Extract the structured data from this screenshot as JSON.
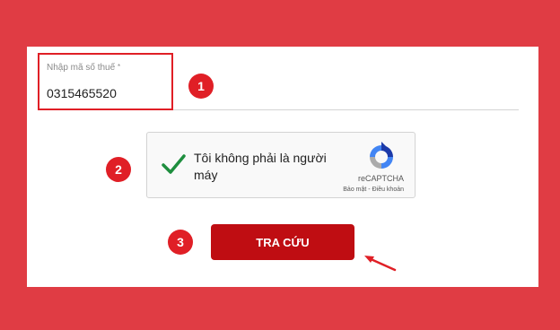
{
  "form": {
    "tax_label": "Nhập mã số thuế",
    "tax_required": "*",
    "tax_value": "0315465520"
  },
  "recaptcha": {
    "text": "Tôi không phải là người máy",
    "brand": "reCAPTCHA",
    "privacy": "Bảo mật",
    "separator": " - ",
    "terms": "Điều khoản"
  },
  "search_button": {
    "label": "TRA CỨU"
  },
  "steps": [
    "1",
    "2",
    "3"
  ],
  "colors": {
    "background": "#e03c44",
    "accent": "#e01f26",
    "button": "#bf0d12",
    "check": "#1e8e3e"
  },
  "icons": [
    "checkmark-icon",
    "recaptcha-logo-icon",
    "arrow-icon"
  ]
}
